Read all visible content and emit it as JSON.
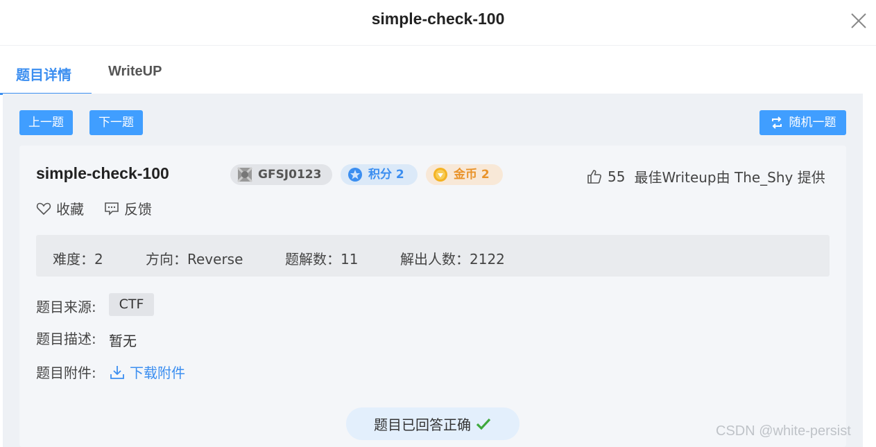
{
  "dialog": {
    "title": "simple-check-100"
  },
  "tabs": [
    {
      "label": "题目详情"
    },
    {
      "label": "WriteUP"
    }
  ],
  "nav": {
    "prev_label": "上一题",
    "next_label": "下一题",
    "random_label": "随机一题"
  },
  "challenge": {
    "name": "simple-check-100",
    "id_tag": "GFSJ0123",
    "score_tag": "积分 2",
    "coin_tag": "金币 2",
    "likes": "55",
    "best_writeup": "最佳Writeup由 The_Shy 提供",
    "favorite_label": "收藏",
    "feedback_label": "反馈"
  },
  "stats": {
    "difficulty": "难度：2",
    "direction": "方向：Reverse",
    "writeups": "题解数：11",
    "solvers": "解出人数：2122"
  },
  "details": {
    "source_label": "题目来源:",
    "source_value": "CTF",
    "description_label": "题目描述:",
    "description_value": "暂无",
    "attachment_label": "题目附件:",
    "attachment_link": "下载附件"
  },
  "status": {
    "text": "题目已回答正确"
  },
  "watermark": "CSDN @white-persist",
  "colors": {
    "accent": "#409eff",
    "success": "#3ea83c",
    "coin": "#e9932a"
  }
}
